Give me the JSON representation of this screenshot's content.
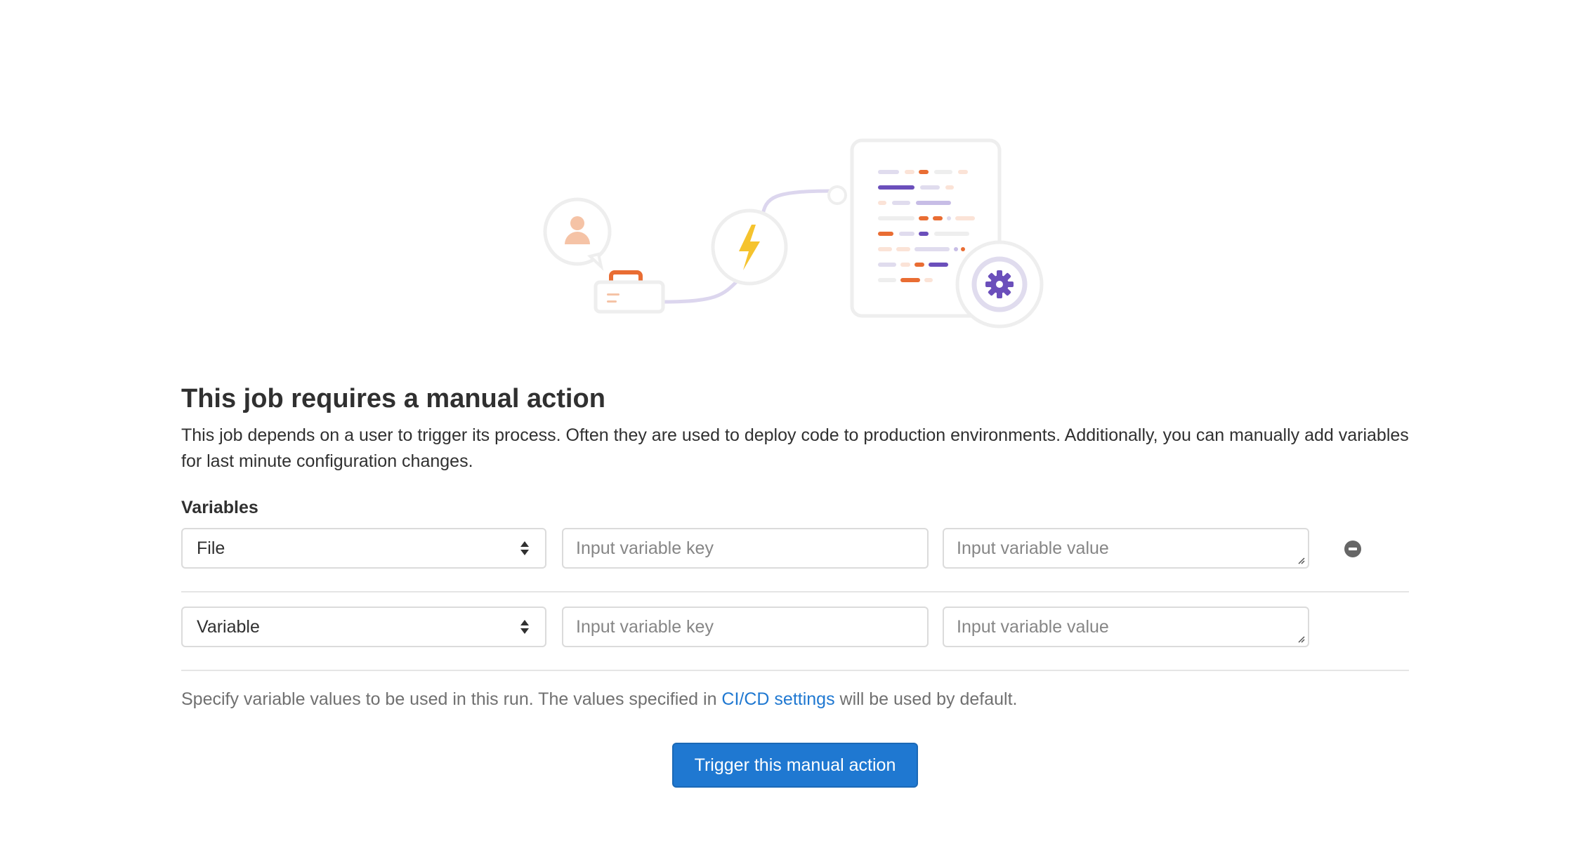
{
  "empty_state": {
    "title": "This job requires a manual action",
    "description": "This job depends on a user to trigger its process. Often they are used to deploy code to production environments. Additionally, you can manually add variables for last minute configuration changes."
  },
  "variables": {
    "label": "Variables",
    "rows": [
      {
        "type": "File",
        "key_placeholder": "Input variable key",
        "value_placeholder": "Input variable value"
      },
      {
        "type": "Variable",
        "key_placeholder": "Input variable key",
        "value_placeholder": "Input variable value"
      }
    ],
    "helper_prefix": "Specify variable values to be used in this run. The values specified in ",
    "helper_link": "CI/CD settings",
    "helper_suffix": " will be used by default."
  },
  "actions": {
    "trigger_label": "Trigger this manual action"
  },
  "colors": {
    "primary": "#1f78d1",
    "orange": "#e96d33",
    "purple": "#6b4fbb",
    "yellow": "#f5c32e"
  }
}
